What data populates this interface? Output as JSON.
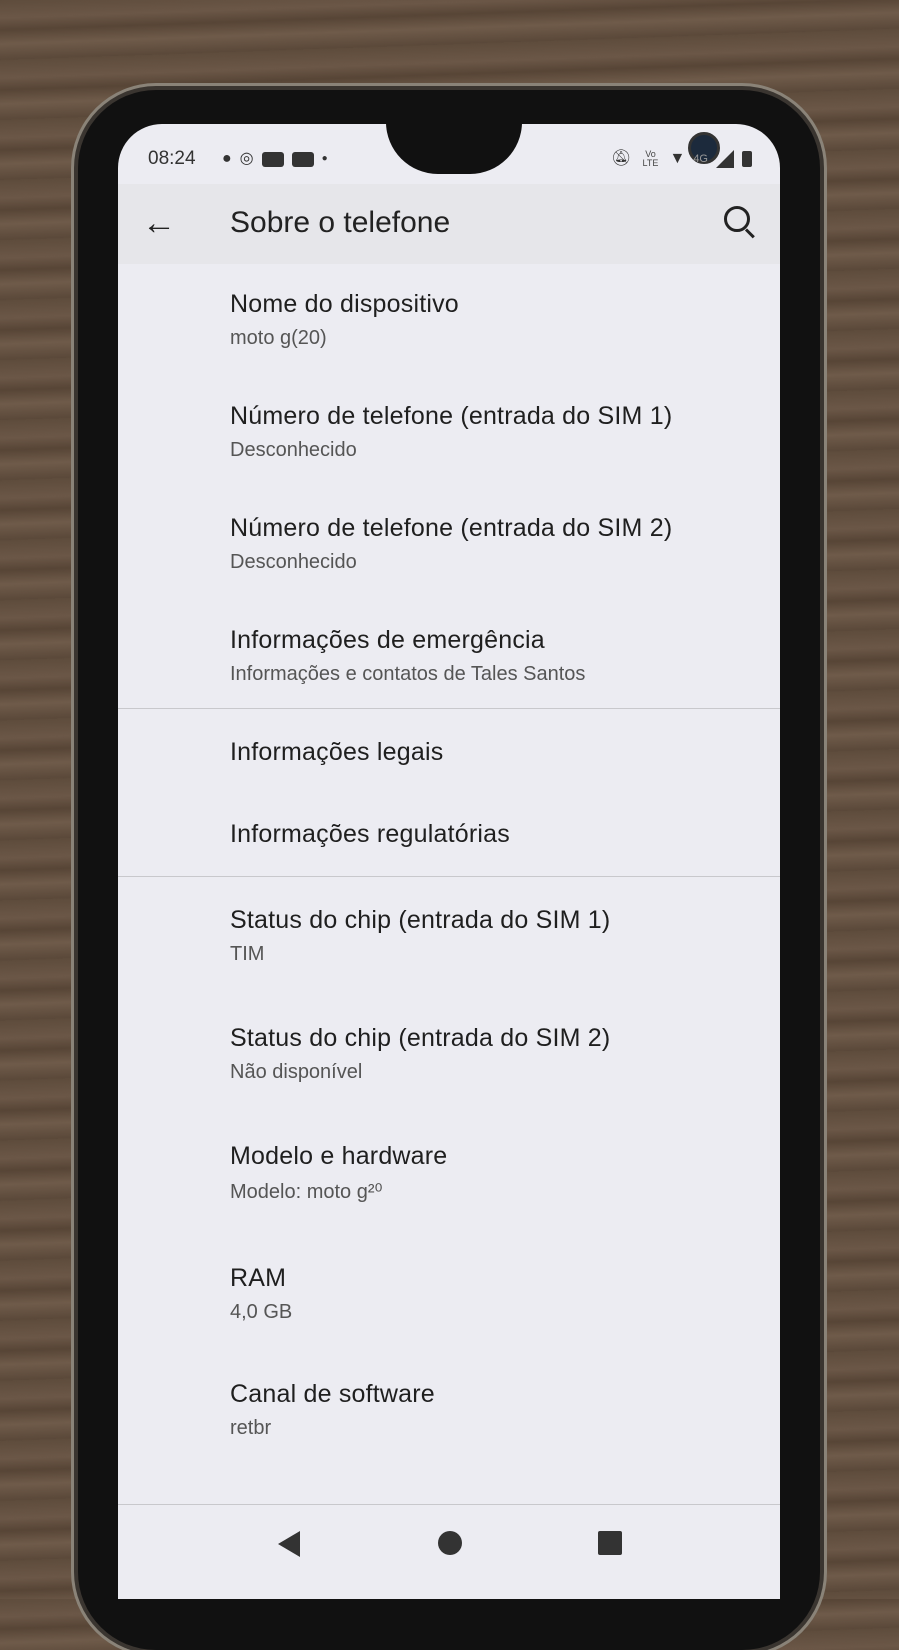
{
  "status_bar": {
    "time": "08:24",
    "left_icons": [
      "chat-bubble-icon",
      "whatsapp-icon",
      "youtube-icon",
      "youtube-icon",
      "dot-icon"
    ],
    "right_icons": [
      "notifications-muted-icon",
      "volte-icon",
      "wifi-icon",
      "signal-icon",
      "battery-icon"
    ],
    "volte_text": "Vo LTE",
    "network": "4G"
  },
  "app_bar": {
    "title": "Sobre o telefone",
    "back_icon": "arrow-back-icon",
    "search_icon": "search-icon"
  },
  "items": [
    {
      "title": "Nome do dispositivo",
      "subtitle": "moto g(20)"
    },
    {
      "title": "Número de telefone (entrada do SIM 1)",
      "subtitle": "Desconhecido"
    },
    {
      "title": "Número de telefone (entrada do SIM 2)",
      "subtitle": "Desconhecido"
    },
    {
      "title": "Informações de emergência",
      "subtitle": "Informações e contatos de Tales Santos"
    },
    {
      "title": "Informações legais"
    },
    {
      "title": "Informações regulatórias"
    },
    {
      "title": "Status do chip (entrada do SIM 1)",
      "subtitle": "TIM"
    },
    {
      "title": "Status do chip (entrada do SIM 2)",
      "subtitle": "Não disponível"
    },
    {
      "title": "Modelo e hardware",
      "subtitle": "Modelo: moto g²⁰"
    },
    {
      "title": "RAM",
      "subtitle": "4,0 GB"
    },
    {
      "title": "Canal de software",
      "subtitle": "retbr"
    }
  ],
  "nav_bar": {
    "icons": [
      "nav-back-icon",
      "nav-home-icon",
      "nav-recents-icon"
    ]
  }
}
